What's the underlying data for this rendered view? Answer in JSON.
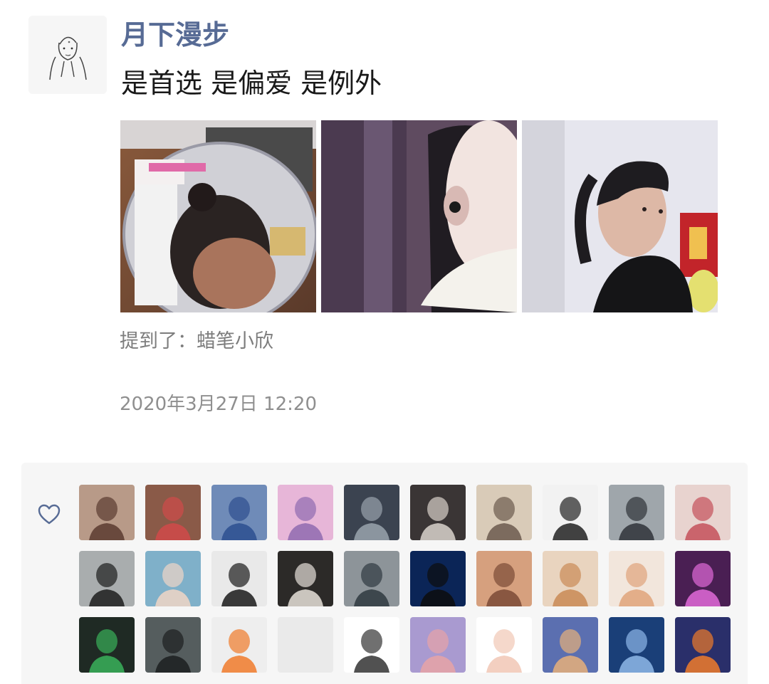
{
  "post": {
    "username": "月下漫步",
    "text": "是首选 是偏爱 是例外",
    "mentioned": "提到了：蜡笔小欣",
    "timestamp": "2020年3月27日 12:20",
    "avatar_icon": "hand-drawn-boy-avatar",
    "photos": [
      {
        "icon": "girl-in-mirror-photo"
      },
      {
        "icon": "girl-face-closeup-photo"
      },
      {
        "icon": "girl-ponytail-photo"
      }
    ]
  },
  "likes": {
    "icon": "heart-outline-icon",
    "colors": {
      "name": "#576b95",
      "panel_bg": "#f6f6f6"
    },
    "likers": [
      {
        "icon": "anime-girl-avatar",
        "bg": "#b89a88",
        "fg": "#5a3b30"
      },
      {
        "icon": "pig-lips-avatar",
        "bg": "#8a5a48",
        "fg": "#d04a4a"
      },
      {
        "icon": "tom-jerry-avatar",
        "bg": "#6f8bb8",
        "fg": "#2d4f8f"
      },
      {
        "icon": "pink-anime-girl-avatar",
        "bg": "#e7b6d8",
        "fg": "#8f6bb0"
      },
      {
        "icon": "dark-anime-boy-avatar",
        "bg": "#3b4350",
        "fg": "#9aa3ad"
      },
      {
        "icon": "hooded-cat-avatar",
        "bg": "#3a3535",
        "fg": "#d9d2cb"
      },
      {
        "icon": "girl-by-window-avatar",
        "bg": "#d9cbb8",
        "fg": "#6b5a4d"
      },
      {
        "icon": "ink-sketch-avatar",
        "bg": "#f2f2f2",
        "fg": "#222222"
      },
      {
        "icon": "seaside-figure-avatar",
        "bg": "#9fa6ab",
        "fg": "#2f3338"
      },
      {
        "icon": "origami-heart-avatar",
        "bg": "#e8d3cf",
        "fg": "#c4505a"
      },
      {
        "icon": "long-hair-girl-avatar",
        "bg": "#a9adae",
        "fg": "#1d1d1d"
      },
      {
        "icon": "cartoon-boy-avatar",
        "bg": "#7fb0c9",
        "fg": "#f0d6c6"
      },
      {
        "icon": "bearded-boy-sketch-avatar",
        "bg": "#e9e9e9",
        "fg": "#1a1a1a"
      },
      {
        "icon": "two-cats-avatar",
        "bg": "#2c2a28",
        "fg": "#e6e0d8"
      },
      {
        "icon": "beach-boy-avatar",
        "bg": "#8d9499",
        "fg": "#2f3940"
      },
      {
        "icon": "blue-portrait-avatar",
        "bg": "#0b2557",
        "fg": "#0d0d0d"
      },
      {
        "icon": "flower-crown-girl-avatar",
        "bg": "#d6a07e",
        "fg": "#7b4a36"
      },
      {
        "icon": "shiba-dog-avatar",
        "bg": "#e9d4bf",
        "fg": "#c98a55"
      },
      {
        "icon": "cute-couple-avatar",
        "bg": "#f2e6dc",
        "fg": "#e0a37a"
      },
      {
        "icon": "neon-heart-girl-avatar",
        "bg": "#4a1f53",
        "fg": "#e06ad8"
      },
      {
        "icon": "green-jacket-avatar",
        "bg": "#1f2a24",
        "fg": "#39b15a"
      },
      {
        "icon": "shadow-stairs-avatar",
        "bg": "#555d5e",
        "fg": "#1c1f20"
      },
      {
        "icon": "buns-boy-avatar",
        "bg": "#eeeeee",
        "fg": "#f07a2a"
      },
      {
        "icon": "blank-avatar",
        "bg": "#eaeaea",
        "fg": "#eaeaea"
      },
      {
        "icon": "hand-drawn-boy-avatar",
        "bg": "#ffffff",
        "fg": "#333333"
      },
      {
        "icon": "pink-pig-avatar",
        "bg": "#a99ad0",
        "fg": "#e8a3a6"
      },
      {
        "icon": "bear-bottle-avatar",
        "bg": "#ffffff",
        "fg": "#f1c7b5"
      },
      {
        "icon": "sunset-tree-avatar",
        "bg": "#5b6fb0",
        "fg": "#e7b07a"
      },
      {
        "icon": "night-sky-avatar",
        "bg": "#1a3f78",
        "fg": "#8fb8e8"
      },
      {
        "icon": "fiery-sea-avatar",
        "bg": "#2a2f6a",
        "fg": "#f07b2a"
      }
    ]
  }
}
